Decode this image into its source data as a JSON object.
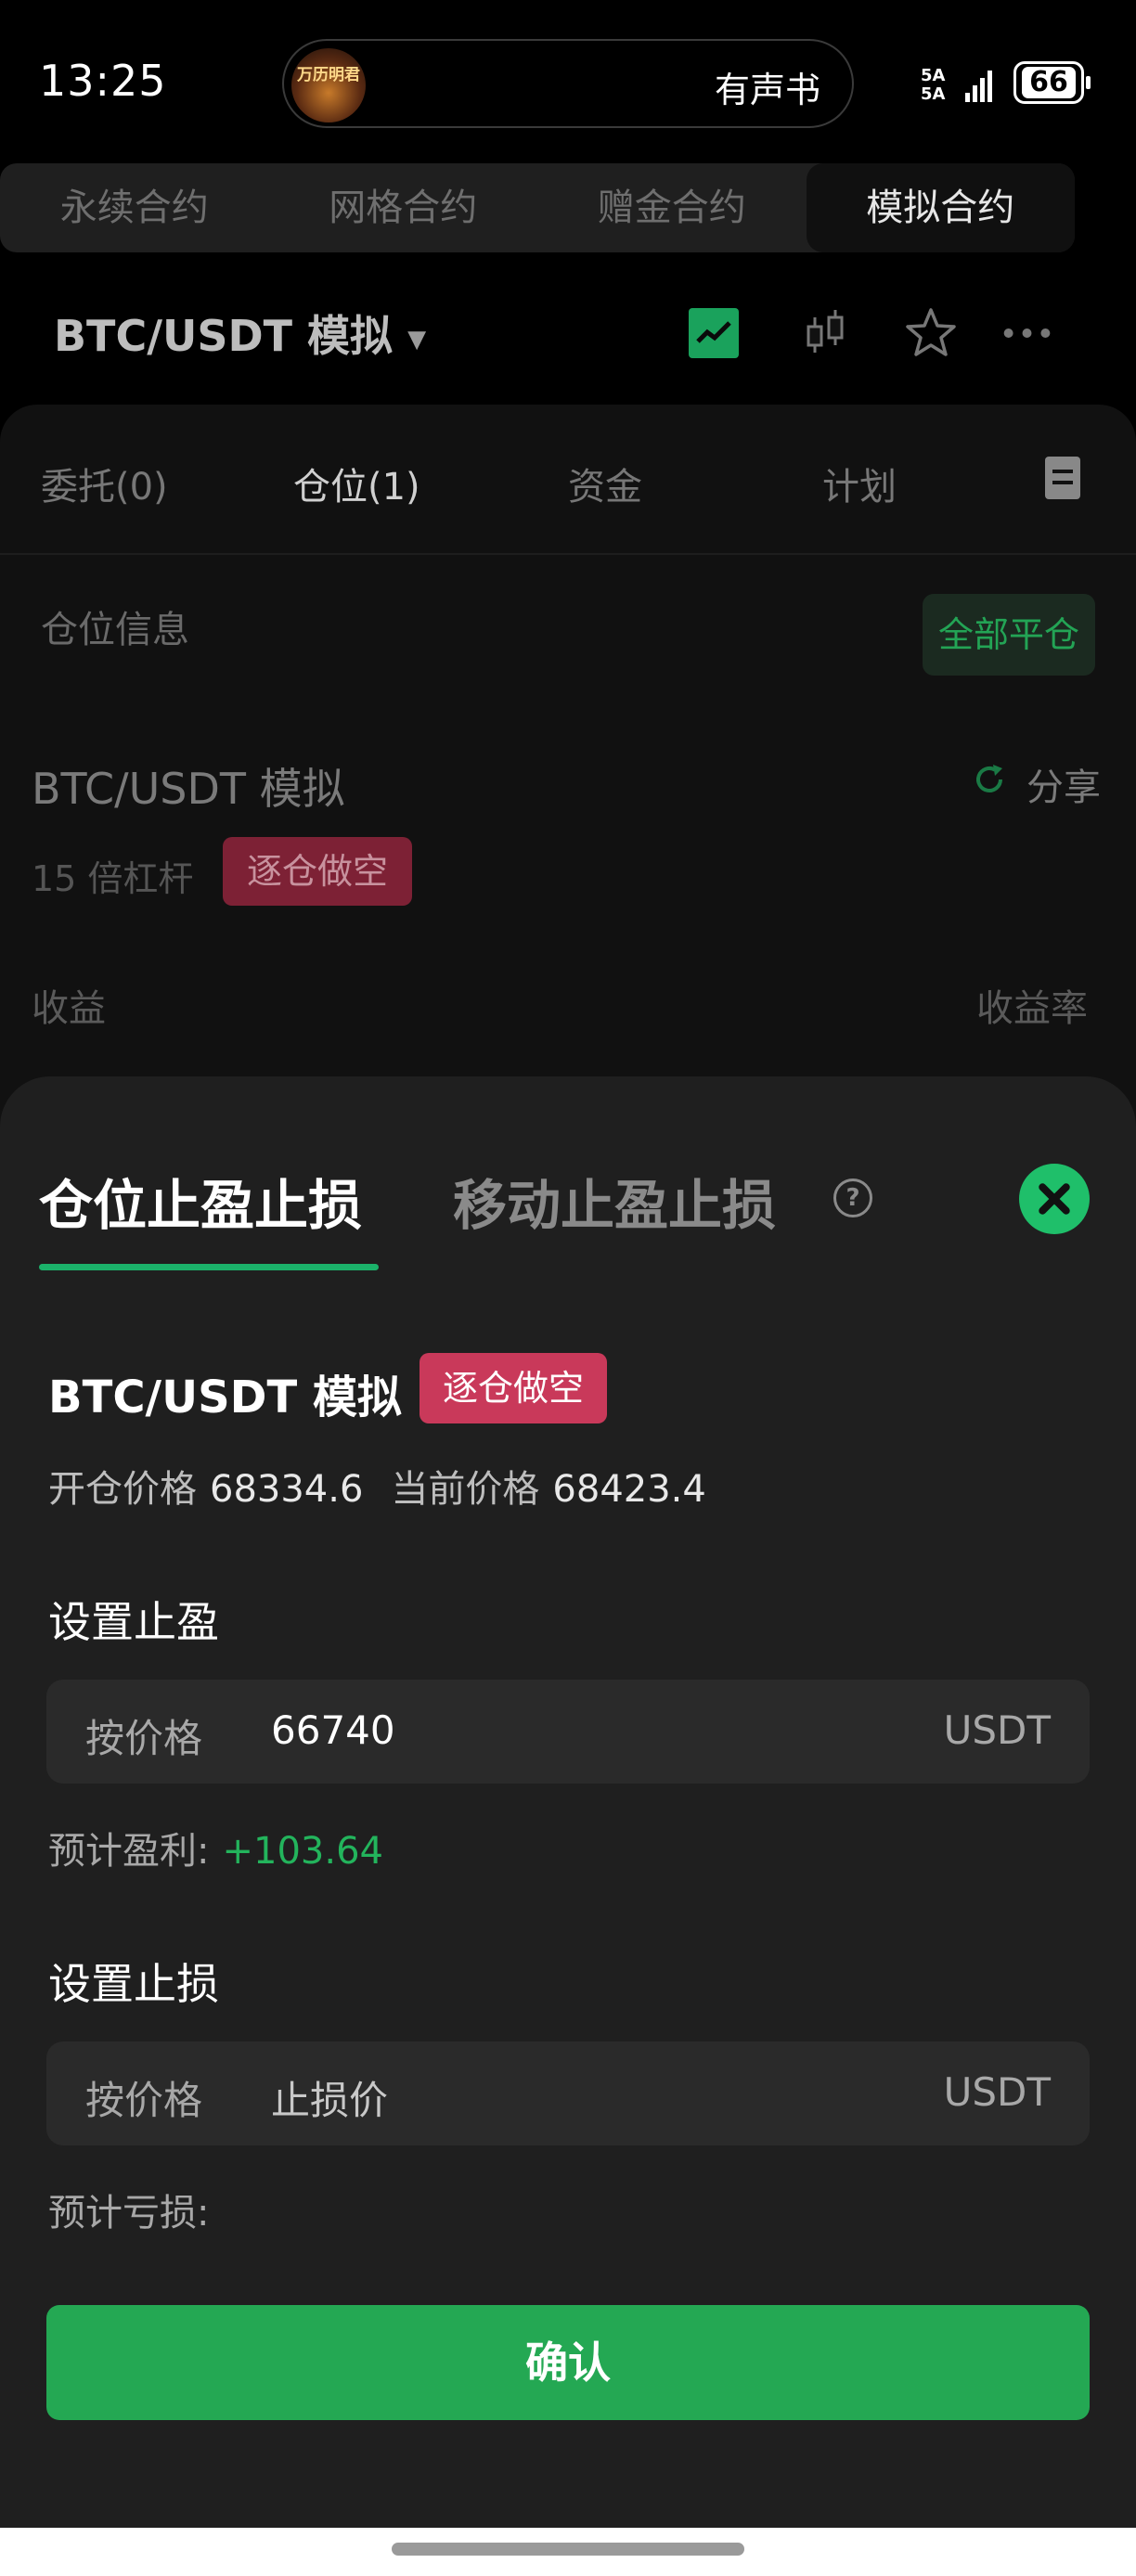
{
  "status_bar": {
    "time": "13:25",
    "media_title": "有声书",
    "media_avatar_text": "万历明君",
    "network": "5A 5A",
    "battery": "66"
  },
  "contract_tabs": [
    {
      "label": "永续合约",
      "active": false
    },
    {
      "label": "网格合约",
      "active": false
    },
    {
      "label": "赠金合约",
      "active": false
    },
    {
      "label": "模拟合约",
      "active": true
    }
  ],
  "header": {
    "pair": "BTC/USDT  模拟",
    "icons": [
      "chart-checked-icon",
      "candlestick-icon",
      "star-icon",
      "more-icon"
    ]
  },
  "position_tabs": [
    {
      "label": "委托(0)"
    },
    {
      "label": "仓位(1)"
    },
    {
      "label": "资金"
    },
    {
      "label": "计划"
    }
  ],
  "position": {
    "section_title": "仓位信息",
    "close_all": "全部平仓",
    "pair": "BTC/USDT 模拟",
    "share": "分享",
    "leverage": "15 倍杠杆",
    "side": "逐仓做空",
    "pnl_label": "收益",
    "pnl_rate_label": "收益率"
  },
  "sheet": {
    "tab_active": "仓位止盈止损",
    "tab_other": "移动止盈止损",
    "pair": "BTC/USDT 模拟",
    "side_badge": "逐仓做空",
    "open_price_label": "开仓价格",
    "open_price": "68334.6",
    "current_price_label": "当前价格",
    "current_price": "68423.4",
    "take_profit": {
      "title": "设置止盈",
      "mode": "按价格",
      "value": "66740",
      "unit": "USDT",
      "estimate_label": "预计盈利:",
      "estimate_value": "+103.64"
    },
    "stop_loss": {
      "title": "设置止损",
      "mode": "按价格",
      "placeholder": "止损价",
      "unit": "USDT",
      "estimate_label": "预计亏损:"
    },
    "confirm": "确认"
  },
  "colors": {
    "accent_green": "#1fbf6a",
    "short_badge": "#c9395a",
    "confirm_button": "#24a853"
  }
}
